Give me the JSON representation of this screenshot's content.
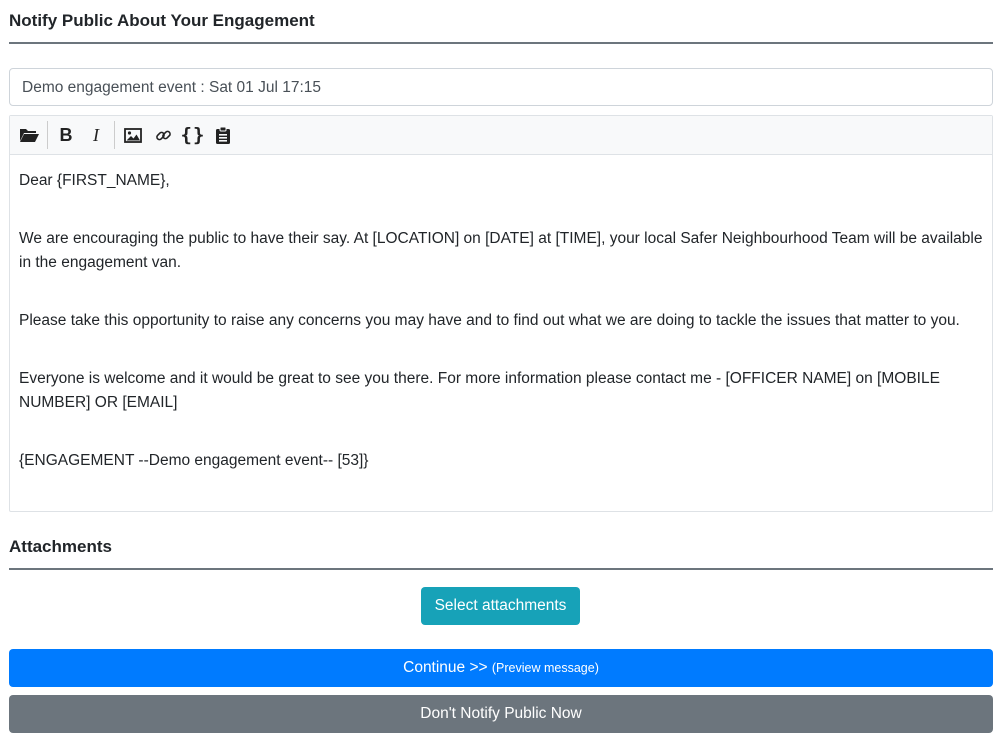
{
  "header": {
    "title": "Notify Public About Your Engagement"
  },
  "subject": {
    "value": "Demo engagement event : Sat 01 Jul 17:15"
  },
  "toolbar": {
    "icons": [
      "folder-open-icon",
      "bold-icon",
      "italic-icon",
      "image-icon",
      "link-icon",
      "braces-icon",
      "clipboard-icon"
    ],
    "bold_label": "B",
    "italic_label": "I",
    "braces_label": "{}"
  },
  "message": {
    "line1": "Dear {FIRST_NAME},",
    "line2": "We are encouraging the public to have their say. At [LOCATION] on [DATE] at [TIME], your local Safer Neighbourhood Team will be available in the engagement van.",
    "line3": "Please take this opportunity to raise any concerns you may have and to find out what we are doing to tackle the issues that matter to you.",
    "line4": "Everyone is welcome and it would be great to see you there. For more information please contact me - [OFFICER NAME] on [MOBILE NUMBER] OR [EMAIL]",
    "line5": "{ENGAGEMENT --Demo engagement event-- [53]}"
  },
  "attachments": {
    "title": "Attachments",
    "select_label": "Select attachments"
  },
  "actions": {
    "continue_label": "Continue >> ",
    "continue_sub": "(Preview message)",
    "dont_notify_label": "Don't Notify Public Now"
  },
  "colors": {
    "info": "#17a2b8",
    "primary": "#007bff",
    "secondary": "#6c757d"
  }
}
